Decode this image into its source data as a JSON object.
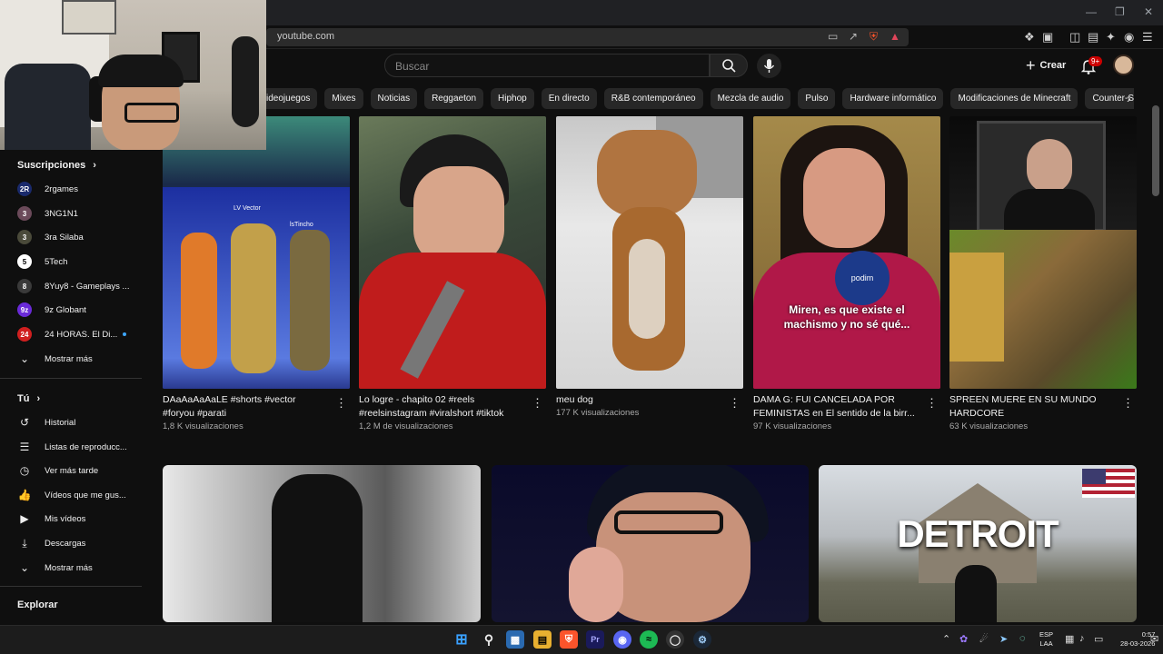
{
  "browser": {
    "url": "youtube.com"
  },
  "header": {
    "search_placeholder": "Buscar",
    "create_label": "Crear",
    "notifications_badge": "9+"
  },
  "chips": [
    "ideojuegos",
    "Mixes",
    "Noticias",
    "Reggaeton",
    "Hiphop",
    "En directo",
    "R&B contemporáneo",
    "Mezcla de audio",
    "Pulso",
    "Hardware informático",
    "Modificaciones de Minecraft",
    "Counter-Strike: Gl"
  ],
  "sidebar": {
    "subscriptions_heading": "Suscripciones",
    "subscriptions": [
      {
        "label": "2rgames",
        "glyph": "2R",
        "color": "#1a2a6c"
      },
      {
        "label": "3NG1N1",
        "glyph": "3",
        "color": "#6b4a5a"
      },
      {
        "label": "3ra Silaba",
        "glyph": "3",
        "color": "#4a4a3a"
      },
      {
        "label": "5Tech",
        "glyph": "5",
        "color": "#ffffff"
      },
      {
        "label": "8Yuy8 - Gameplays ...",
        "glyph": "8",
        "color": "#3a3a3a"
      },
      {
        "label": "9z Globant",
        "glyph": "9z",
        "color": "#6a2ad8"
      },
      {
        "label": "24 HORAS. El Di...",
        "glyph": "24",
        "color": "#d01f1f"
      }
    ],
    "show_more_1": "Mostrar más",
    "you_heading": "Tú",
    "you_items": [
      {
        "label": "Historial",
        "icon": "history-icon",
        "glyph": "↺"
      },
      {
        "label": "Listas de reproducc...",
        "icon": "playlist-icon",
        "glyph": "☰"
      },
      {
        "label": "Ver más tarde",
        "icon": "clock-icon",
        "glyph": "◷"
      },
      {
        "label": "Vídeos que me gus...",
        "icon": "thumbs-up-icon",
        "glyph": "👍"
      },
      {
        "label": "Mis vídeos",
        "icon": "my-videos-icon",
        "glyph": "▶"
      },
      {
        "label": "Descargas",
        "icon": "download-icon",
        "glyph": "⤓"
      }
    ],
    "show_more_2": "Mostrar más",
    "explore_heading": "Explorar"
  },
  "shorts": [
    {
      "title": "DAaAaAaAaLE  #shorts #vector #foryou #parati",
      "views": "1,8 K visualizaciones"
    },
    {
      "title": "Lo logre - chapito 02 #reels #reelsinstagram #viralshort #tiktok",
      "views": "1,2 M de visualizaciones"
    },
    {
      "title": "meu dog",
      "views": "177 K visualizaciones"
    },
    {
      "title": "DAMA G: FUI CANCELADA POR FEMINISTAS en El sentido de la birr...",
      "views": "97 K visualizaciones"
    },
    {
      "title": "SPREEN MUERE EN SU MUNDO HARDCORE",
      "views": "63 K visualizaciones"
    }
  ],
  "thumb_texts": {
    "short4_caption": "Miren, es que existe el machismo y no sé qué...",
    "short4_mic": "podim",
    "short1_name1": "LV Vector",
    "short1_name2": "lsTincho",
    "video3_title_overlay": "DETROIT"
  },
  "taskbar": {
    "lang_top": "ESP",
    "lang_bottom": "LAA",
    "time": "0:57",
    "date": "28-03-2026"
  },
  "colors": {
    "background": "#0f0f0f",
    "chip": "#272727",
    "notification_badge": "#cc0000"
  }
}
